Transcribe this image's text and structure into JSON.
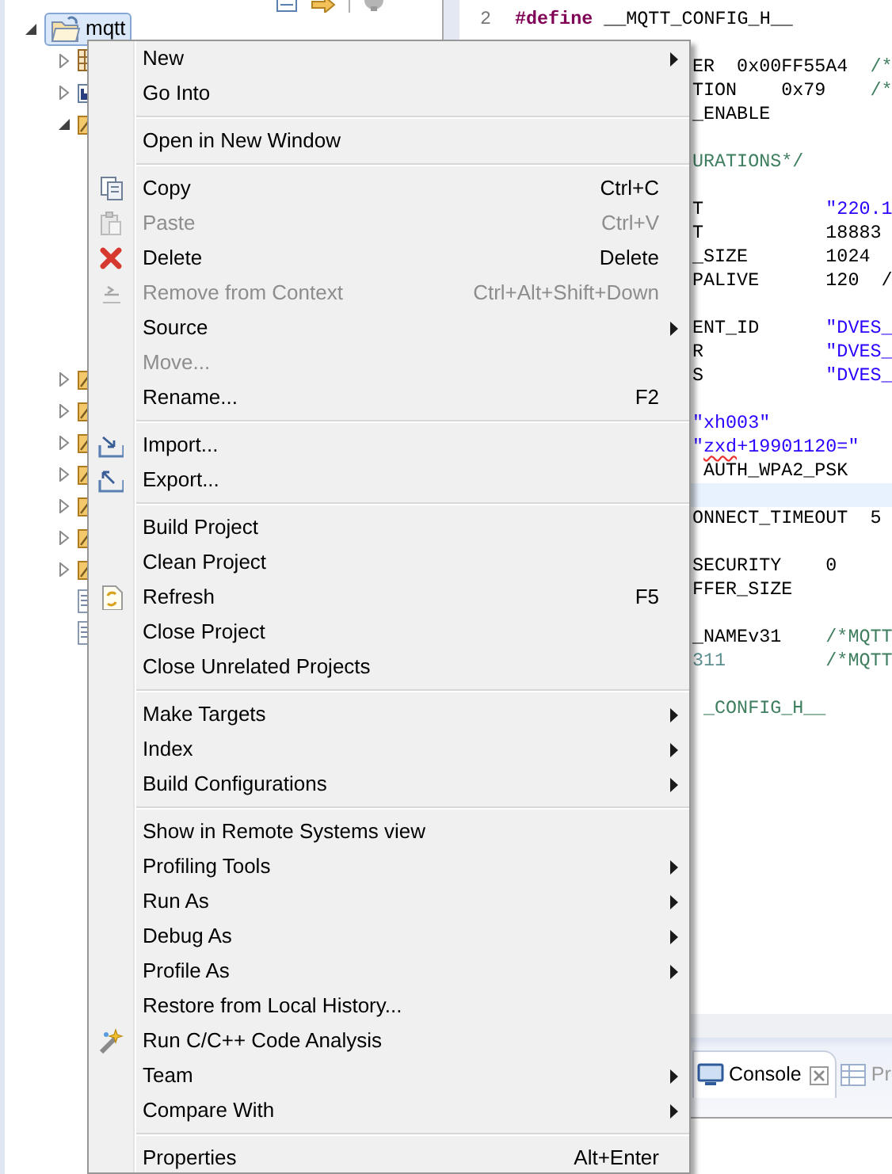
{
  "explorer": {
    "toolbar": [
      {
        "kind": "document"
      },
      {
        "kind": "arrow"
      },
      {
        "kind": "cog"
      }
    ],
    "tree": [
      {
        "label": "mqtt",
        "kind": "project",
        "selected": true,
        "expanded": true,
        "children": [
          {
            "kind": "binaries",
            "expanded": false
          },
          {
            "kind": "includes",
            "expanded": false
          },
          {
            "kind": "folder",
            "expanded": true
          },
          {
            "kind": "folder",
            "expanded": false
          },
          {
            "kind": "folder",
            "expanded": false
          },
          {
            "kind": "folder",
            "expanded": false
          },
          {
            "kind": "folder",
            "expanded": false
          },
          {
            "kind": "folder",
            "expanded": false
          },
          {
            "kind": "folder",
            "expanded": false
          },
          {
            "kind": "folder",
            "expanded": false
          },
          {
            "kind": "file"
          },
          {
            "kind": "file"
          }
        ]
      }
    ]
  },
  "editor": {
    "lines": [
      {
        "number": "2",
        "current": false,
        "segments": [
          {
            "text": "#define",
            "kind": "keyword"
          },
          {
            "text": " __MQTT_CONFIG_H__",
            "kind": "plain"
          }
        ]
      },
      {
        "current": false
      },
      {
        "current": false,
        "segments": [
          {
            "text": "ER  0x00FF55A4  ",
            "kind": "plain"
          },
          {
            "text": "/*",
            "kind": "comment"
          }
        ]
      },
      {
        "current": false,
        "segments": [
          {
            "text": "TION    0x79    ",
            "kind": "plain"
          },
          {
            "text": "/*",
            "kind": "comment"
          }
        ]
      },
      {
        "current": false,
        "segments": [
          {
            "text": "_ENABLE",
            "kind": "plain"
          }
        ]
      },
      {
        "current": false
      },
      {
        "current": false,
        "segments": [
          {
            "text": "URATIONS*/",
            "kind": "comment"
          }
        ]
      },
      {
        "current": false
      },
      {
        "current": false,
        "segments": [
          {
            "text": "T           ",
            "kind": "plain"
          },
          {
            "text": "\"220.1",
            "kind": "string"
          }
        ]
      },
      {
        "current": false,
        "segments": [
          {
            "text": "T           18883",
            "kind": "plain"
          }
        ]
      },
      {
        "current": false,
        "segments": [
          {
            "text": "_SIZE       1024",
            "kind": "plain"
          }
        ]
      },
      {
        "current": false,
        "segments": [
          {
            "text": "PALIVE      120  /",
            "kind": "plain"
          }
        ]
      },
      {
        "current": false
      },
      {
        "current": false,
        "segments": [
          {
            "text": "ENT_ID      ",
            "kind": "plain"
          },
          {
            "text": "\"DVES_",
            "kind": "string"
          }
        ]
      },
      {
        "current": false,
        "segments": [
          {
            "text": "R           ",
            "kind": "plain"
          },
          {
            "text": "\"DVES_",
            "kind": "string"
          }
        ]
      },
      {
        "current": false,
        "segments": [
          {
            "text": "S           ",
            "kind": "plain"
          },
          {
            "text": "\"DVES_",
            "kind": "string"
          }
        ]
      },
      {
        "current": false
      },
      {
        "current": false,
        "segments": [
          {
            "text": "\"xh003\"",
            "kind": "string"
          }
        ]
      },
      {
        "current": false,
        "segments": [
          {
            "text": "\"",
            "kind": "string"
          },
          {
            "text": "zxd",
            "kind": "string",
            "misspelled": true
          },
          {
            "text": "+19901120=\"",
            "kind": "string"
          }
        ]
      },
      {
        "current": false,
        "segments": [
          {
            "text": " AUTH_WPA2_PSK",
            "kind": "plain"
          }
        ]
      },
      {
        "current": true
      },
      {
        "current": false,
        "segments": [
          {
            "text": "ONNECT_TIMEOUT  5",
            "kind": "plain"
          }
        ]
      },
      {
        "current": false
      },
      {
        "current": false,
        "segments": [
          {
            "text": "SECURITY    0",
            "kind": "plain"
          }
        ]
      },
      {
        "current": false,
        "segments": [
          {
            "text": "FFER_SIZE",
            "kind": "plain"
          }
        ]
      },
      {
        "current": false
      },
      {
        "current": false,
        "segments": [
          {
            "text": "_NAMEv31    ",
            "kind": "plain"
          },
          {
            "text": "/*MQTT",
            "kind": "comment"
          }
        ]
      },
      {
        "current": false,
        "segments": [
          {
            "text": "311",
            "kind": "constant"
          },
          {
            "text": "         /*MQTT",
            "kind": "comment"
          }
        ]
      },
      {
        "current": false
      },
      {
        "current": false,
        "segments": [
          {
            "text": " _CONFIG_H__",
            "kind": "comment"
          }
        ]
      }
    ]
  },
  "panel": {
    "tabs": [
      {
        "label": "Console",
        "selected": true
      },
      {
        "label": "Pr",
        "selected": false
      }
    ]
  },
  "context_menu": {
    "items": [
      {
        "kind": "item",
        "label": "New",
        "submenu": true,
        "disabled": false
      },
      {
        "kind": "item",
        "label": "Go Into",
        "submenu": false,
        "disabled": false
      },
      {
        "kind": "separator"
      },
      {
        "kind": "item",
        "label": "Open in New Window",
        "submenu": false,
        "disabled": false
      },
      {
        "kind": "separator"
      },
      {
        "kind": "item",
        "label": "Copy",
        "shortcut": "Ctrl+C",
        "submenu": false,
        "disabled": false
      },
      {
        "kind": "item",
        "label": "Paste",
        "shortcut": "Ctrl+V",
        "submenu": false,
        "disabled": true
      },
      {
        "kind": "item",
        "label": "Delete",
        "shortcut": "Delete",
        "submenu": false,
        "disabled": false
      },
      {
        "kind": "item",
        "label": "Remove from Context",
        "shortcut": "Ctrl+Alt+Shift+Down",
        "submenu": false,
        "disabled": true
      },
      {
        "kind": "item",
        "label": "Source",
        "submenu": true,
        "disabled": false
      },
      {
        "kind": "item",
        "label": "Move...",
        "submenu": false,
        "disabled": true
      },
      {
        "kind": "item",
        "label": "Rename...",
        "shortcut": "F2",
        "submenu": false,
        "disabled": false
      },
      {
        "kind": "separator"
      },
      {
        "kind": "item",
        "label": "Import...",
        "submenu": false,
        "disabled": false
      },
      {
        "kind": "item",
        "label": "Export...",
        "submenu": false,
        "disabled": false
      },
      {
        "kind": "separator"
      },
      {
        "kind": "item",
        "label": "Build Project",
        "submenu": false,
        "disabled": false
      },
      {
        "kind": "item",
        "label": "Clean Project",
        "submenu": false,
        "disabled": false
      },
      {
        "kind": "item",
        "label": "Refresh",
        "shortcut": "F5",
        "submenu": false,
        "disabled": false
      },
      {
        "kind": "item",
        "label": "Close Project",
        "submenu": false,
        "disabled": false
      },
      {
        "kind": "item",
        "label": "Close Unrelated Projects",
        "submenu": false,
        "disabled": false
      },
      {
        "kind": "separator"
      },
      {
        "kind": "item",
        "label": "Make Targets",
        "submenu": true,
        "disabled": false
      },
      {
        "kind": "item",
        "label": "Index",
        "submenu": true,
        "disabled": false
      },
      {
        "kind": "item",
        "label": "Build Configurations",
        "submenu": true,
        "disabled": false
      },
      {
        "kind": "separator"
      },
      {
        "kind": "item",
        "label": "Show in Remote Systems view",
        "submenu": false,
        "disabled": false
      },
      {
        "kind": "item",
        "label": "Profiling Tools",
        "submenu": true,
        "disabled": false
      },
      {
        "kind": "item",
        "label": "Run As",
        "submenu": true,
        "disabled": false
      },
      {
        "kind": "item",
        "label": "Debug As",
        "submenu": true,
        "disabled": false
      },
      {
        "kind": "item",
        "label": "Profile As",
        "submenu": true,
        "disabled": false
      },
      {
        "kind": "item",
        "label": "Restore from Local History...",
        "submenu": false,
        "disabled": false
      },
      {
        "kind": "item",
        "label": "Run C/C++ Code Analysis",
        "submenu": false,
        "disabled": false
      },
      {
        "kind": "item",
        "label": "Team",
        "submenu": true,
        "disabled": false
      },
      {
        "kind": "item",
        "label": "Compare With",
        "submenu": true,
        "disabled": false
      },
      {
        "kind": "separator"
      },
      {
        "kind": "item",
        "label": "Properties",
        "shortcut": "Alt+Enter",
        "submenu": false,
        "disabled": false
      }
    ]
  }
}
